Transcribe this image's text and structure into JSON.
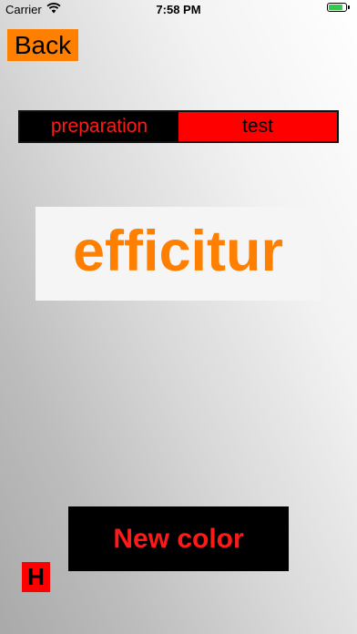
{
  "status_bar": {
    "carrier": "Carrier",
    "time": "7:58 PM",
    "wifi_icon": "wifi-icon",
    "battery_icon": "battery-icon",
    "battery_level": 0.85,
    "battery_color": "#33c94a"
  },
  "nav": {
    "back_label": "Back"
  },
  "mode_selector": {
    "segments": [
      {
        "label": "preparation",
        "selected": false
      },
      {
        "label": "test",
        "selected": true
      }
    ]
  },
  "word": {
    "text": "efficitur",
    "color": "#ff8000"
  },
  "actions": {
    "new_color_label": "New color",
    "h_label": "H"
  },
  "colors": {
    "accent_orange": "#ff8000",
    "accent_red": "#ff0000"
  }
}
